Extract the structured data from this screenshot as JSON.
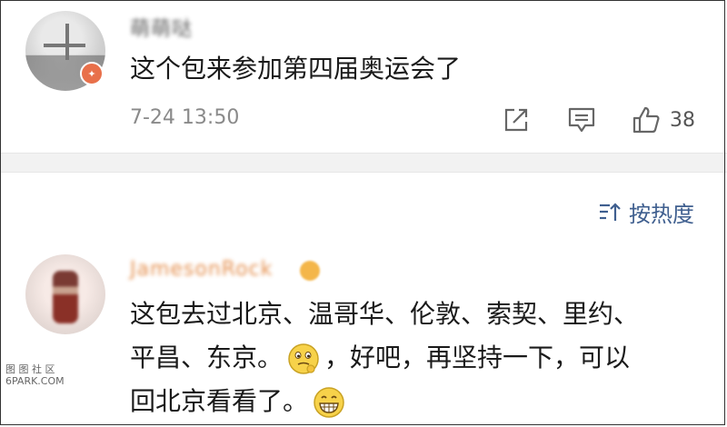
{
  "comments": [
    {
      "username": "萌萌哒",
      "text": "这个包来参加第四届奥运会了",
      "time": "7-24 13:50",
      "likes": "38"
    },
    {
      "username": "JamesonRock",
      "text_line1": "这包去过北京、温哥华、伦敦、索契、里约、",
      "text_line2_a": "平昌、东京。",
      "text_line2_b": "，好吧，再坚持一下，可以",
      "text_line3": "回北京看看了。"
    }
  ],
  "sort": {
    "label": "按热度"
  },
  "watermark": {
    "line1": "图 图 社 区",
    "line2": "6PARK.COM"
  },
  "colors": {
    "link": "#3f5f8f",
    "meta": "#8a8a8a",
    "divider": "#f2f2f2"
  },
  "icons": [
    "share-icon",
    "comment-reply-icon",
    "thumbs-up-icon",
    "sort-icon",
    "thinking-emoji-icon",
    "grin-emoji-icon"
  ]
}
